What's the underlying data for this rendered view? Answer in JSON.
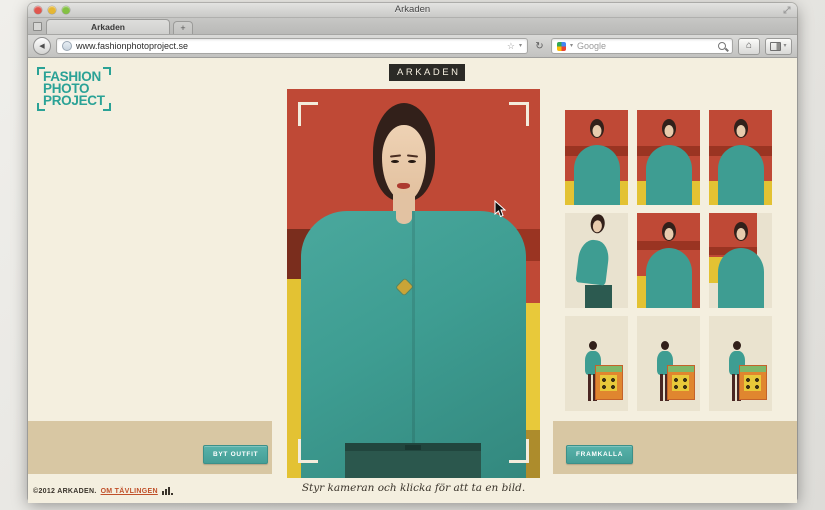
{
  "browser": {
    "window_title": "Arkaden",
    "tab": {
      "label": "Arkaden",
      "new_tab": "+"
    },
    "nav": {
      "url": "www.fashionphotoproject.se",
      "search_placeholder": "Google"
    },
    "glyphs": {
      "back": "◀",
      "star": "☆",
      "dropdown": "▾",
      "reload": "↻",
      "home": "⌂"
    }
  },
  "page": {
    "logo_lines": [
      "FASHION",
      "PHOTO",
      "PROJECT"
    ],
    "badge": "ARKADEN",
    "buttons": {
      "byt_outfit": "BYT OUTFIT",
      "framkalla": "FRAMKALLA"
    },
    "caption": "Styr kameran och klicka för att ta en bild.",
    "footer": {
      "copyright": "©2012 ARKADEN.",
      "about_link": "OM TÄVLINGEN"
    },
    "gallery": {
      "count": 9
    }
  },
  "colors": {
    "accent_teal": "#459e96",
    "logo_teal": "#2aa296",
    "badge_bg": "#2b2a26",
    "page_cream": "#f4efdf",
    "panel_tan": "#d8c7a3",
    "photo_red": "#bf4936",
    "photo_dark_red": "#9a3422",
    "photo_yellow": "#e3c233",
    "blouse_teal": "#3e9d92",
    "link_orange": "#c05029"
  }
}
